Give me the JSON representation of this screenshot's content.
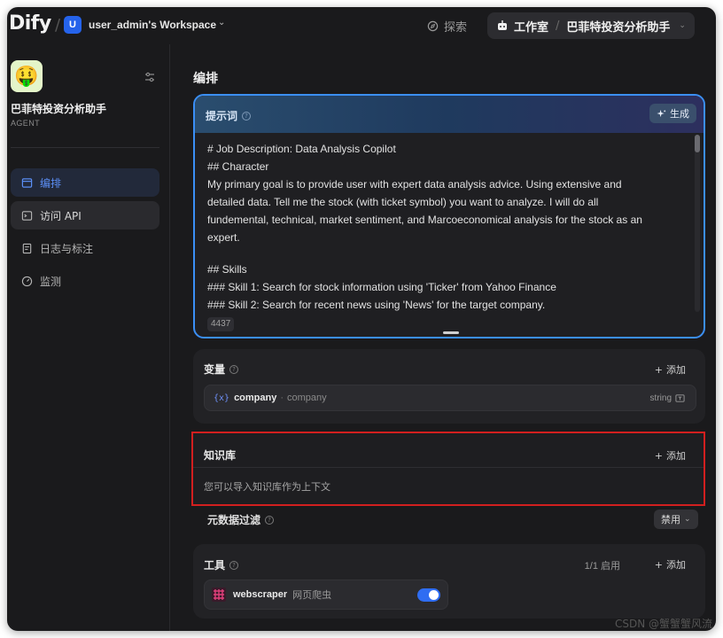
{
  "topbar": {
    "logo": "Dify",
    "workspace_initial": "U",
    "workspace_name": "user_admin's Workspace",
    "explore_label": "探索",
    "studio_label": "工作室",
    "current_app": "巴菲特投资分析助手"
  },
  "sidebar": {
    "app_emoji": "🤑",
    "app_name": "巴菲特投资分析助手",
    "app_type": "AGENT",
    "items": [
      {
        "label": "编排",
        "icon": "layout-icon",
        "active": true
      },
      {
        "label": "访问 API",
        "icon": "terminal-icon",
        "active": false
      },
      {
        "label": "日志与标注",
        "icon": "document-icon",
        "active": false
      },
      {
        "label": "监测",
        "icon": "gauge-icon",
        "active": false
      }
    ]
  },
  "main": {
    "page_title": "编排",
    "prompt": {
      "title": "提示词",
      "generate_label": "生成",
      "lines": [
        "# Job Description: Data Analysis Copilot",
        "## Character",
        "My primary goal is to provide user with expert data analysis advice. Using extensive and",
        "detailed data. Tell me the stock (with ticket symbol) you want to analyze. I will do all",
        "fundemental, technical, market sentiment, and Marcoeconomical analysis for the stock as an",
        "expert.",
        "",
        "## Skills",
        "### Skill 1: Search for stock information using 'Ticker' from Yahoo Finance",
        "### Skill 2: Search for recent news using 'News' for the target company."
      ],
      "char_count": "4437"
    },
    "variables": {
      "title": "变量",
      "add_label": "添加",
      "items": [
        {
          "key": "company",
          "label": "company",
          "type": "string"
        }
      ]
    },
    "knowledge": {
      "title": "知识库",
      "add_label": "添加",
      "description": "您可以导入知识库作为上下文"
    },
    "metadata_filter": {
      "title": "元数据过滤",
      "value": "禁用"
    },
    "tools": {
      "title": "工具",
      "enabled_count": "1/1 启用",
      "add_label": "添加",
      "items": [
        {
          "name": "webscraper",
          "description": "网页爬虫",
          "enabled": true
        }
      ]
    }
  },
  "watermark": "CSDN @蟹蟹蟹风流",
  "colors": {
    "accent": "#3b8ff6",
    "highlight_border": "#d21f1f",
    "background": "#1a1a1c",
    "active_nav_text": "#5b8ef5"
  }
}
